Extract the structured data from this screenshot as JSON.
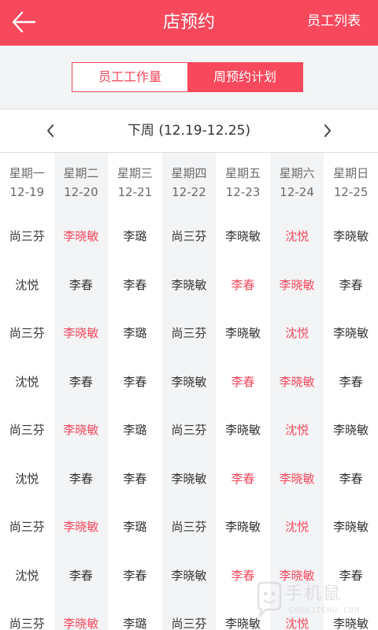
{
  "header": {
    "title": "店预约",
    "action_label": "员工列表"
  },
  "tabs": [
    {
      "label": "员工工作量",
      "active": false
    },
    {
      "label": "周预约计划",
      "active": true
    }
  ],
  "week_nav": {
    "label": "下周 (12.19-12.25)"
  },
  "days": [
    {
      "name": "星期一",
      "date": "12-19",
      "shaded": false,
      "cells": [
        {
          "name": "尚三芬",
          "hl": false
        },
        {
          "name": "沈悦",
          "hl": false
        },
        {
          "name": "尚三芬",
          "hl": false
        },
        {
          "name": "沈悦",
          "hl": false
        },
        {
          "name": "尚三芬",
          "hl": false
        },
        {
          "name": "沈悦",
          "hl": false
        },
        {
          "name": "尚三芬",
          "hl": false
        },
        {
          "name": "沈悦",
          "hl": false
        },
        {
          "name": "尚三芬",
          "hl": false
        }
      ]
    },
    {
      "name": "星期二",
      "date": "12-20",
      "shaded": true,
      "cells": [
        {
          "name": "李晓敏",
          "hl": true
        },
        {
          "name": "李春",
          "hl": false
        },
        {
          "name": "李晓敏",
          "hl": true
        },
        {
          "name": "李春",
          "hl": false
        },
        {
          "name": "李晓敏",
          "hl": true
        },
        {
          "name": "李春",
          "hl": false
        },
        {
          "name": "李晓敏",
          "hl": true
        },
        {
          "name": "李春",
          "hl": false
        },
        {
          "name": "李晓敏",
          "hl": true
        }
      ]
    },
    {
      "name": "星期三",
      "date": "12-21",
      "shaded": false,
      "cells": [
        {
          "name": "李璐",
          "hl": false
        },
        {
          "name": "李春",
          "hl": false
        },
        {
          "name": "李璐",
          "hl": false
        },
        {
          "name": "李春",
          "hl": false
        },
        {
          "name": "李璐",
          "hl": false
        },
        {
          "name": "李春",
          "hl": false
        },
        {
          "name": "李璐",
          "hl": false
        },
        {
          "name": "李春",
          "hl": false
        },
        {
          "name": "李璐",
          "hl": false
        }
      ]
    },
    {
      "name": "星期四",
      "date": "12-22",
      "shaded": true,
      "cells": [
        {
          "name": "尚三芬",
          "hl": false
        },
        {
          "name": "李晓敏",
          "hl": false
        },
        {
          "name": "尚三芬",
          "hl": false
        },
        {
          "name": "李晓敏",
          "hl": false
        },
        {
          "name": "尚三芬",
          "hl": false
        },
        {
          "name": "李晓敏",
          "hl": false
        },
        {
          "name": "尚三芬",
          "hl": false
        },
        {
          "name": "李晓敏",
          "hl": false
        },
        {
          "name": "尚三芬",
          "hl": false
        }
      ]
    },
    {
      "name": "星期五",
      "date": "12-23",
      "shaded": false,
      "cells": [
        {
          "name": "李晓敏",
          "hl": false
        },
        {
          "name": "李春",
          "hl": true
        },
        {
          "name": "李晓敏",
          "hl": false
        },
        {
          "name": "李春",
          "hl": true
        },
        {
          "name": "李晓敏",
          "hl": false
        },
        {
          "name": "李春",
          "hl": true
        },
        {
          "name": "李晓敏",
          "hl": false
        },
        {
          "name": "李春",
          "hl": true
        },
        {
          "name": "李晓敏",
          "hl": false
        }
      ]
    },
    {
      "name": "星期六",
      "date": "12-24",
      "shaded": true,
      "cells": [
        {
          "name": "沈悦",
          "hl": true
        },
        {
          "name": "李晓敏",
          "hl": true
        },
        {
          "name": "沈悦",
          "hl": true
        },
        {
          "name": "李晓敏",
          "hl": true
        },
        {
          "name": "沈悦",
          "hl": true
        },
        {
          "name": "李晓敏",
          "hl": true
        },
        {
          "name": "沈悦",
          "hl": true
        },
        {
          "name": "李晓敏",
          "hl": true
        },
        {
          "name": "沈悦",
          "hl": true
        }
      ]
    },
    {
      "name": "星期日",
      "date": "12-25",
      "shaded": false,
      "cells": [
        {
          "name": "李晓敏",
          "hl": false
        },
        {
          "name": "李春",
          "hl": false
        },
        {
          "name": "李晓敏",
          "hl": false
        },
        {
          "name": "李春",
          "hl": false
        },
        {
          "name": "李晓敏",
          "hl": false
        },
        {
          "name": "李春",
          "hl": false
        },
        {
          "name": "李晓敏",
          "hl": false
        },
        {
          "name": "李春",
          "hl": false
        },
        {
          "name": "李晓敏",
          "hl": false
        }
      ]
    }
  ],
  "watermark": {
    "text": "手机鼠",
    "sub": "SHOUJISHU.COM"
  },
  "colors": {
    "accent": "#f7485c",
    "shaded": "#f3f4f5",
    "text": "#333333"
  }
}
